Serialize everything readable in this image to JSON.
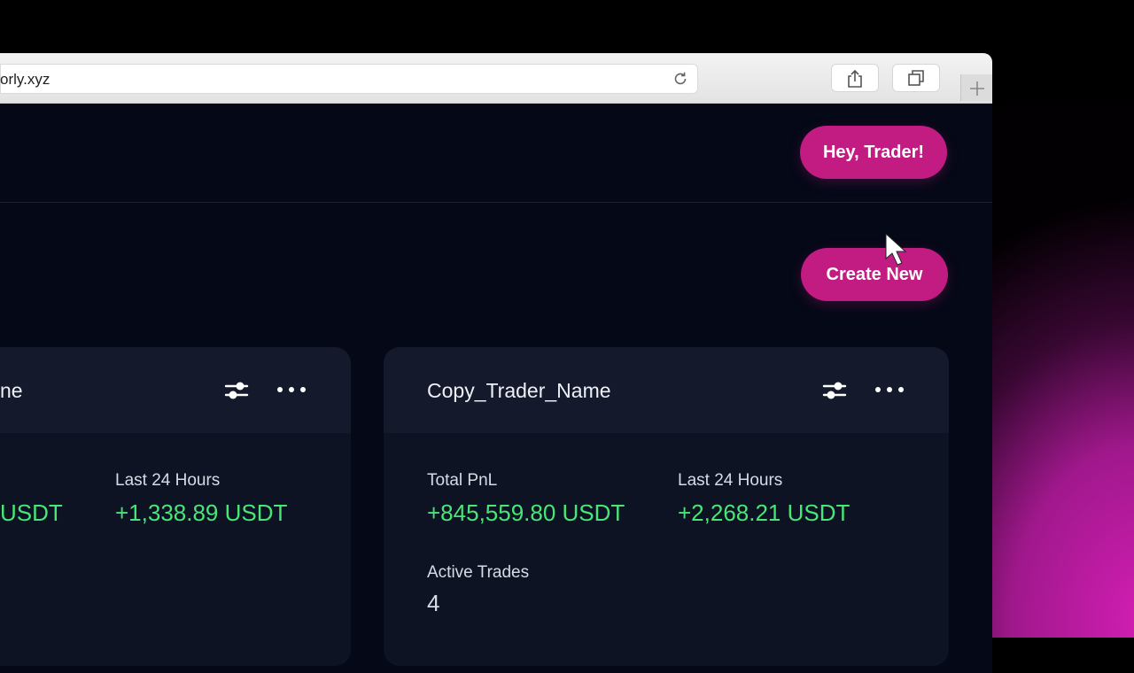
{
  "colors": {
    "accent": "#c21b82",
    "positive": "#47e676",
    "background": "#050817",
    "card": "#0e1324"
  },
  "browser": {
    "url": "orly.xyz",
    "icons": [
      "reload-icon",
      "share-icon",
      "tabs-icon",
      "plus-icon"
    ]
  },
  "header": {
    "greeting": "Hey, Trader!"
  },
  "toolbar": {
    "create_label": "Create New"
  },
  "cards": [
    {
      "title": "ne",
      "stats": [
        {
          "label": "",
          "value": "USDT"
        },
        {
          "label": "Last 24 Hours",
          "value": "+1,338.89 USDT"
        }
      ]
    },
    {
      "title": "Copy_Trader_Name",
      "stats": [
        {
          "label": "Total PnL",
          "value": "+845,559.80 USDT"
        },
        {
          "label": "Last 24 Hours",
          "value": "+2,268.21 USDT"
        },
        {
          "label": "Active Trades",
          "value": "4"
        }
      ]
    }
  ]
}
